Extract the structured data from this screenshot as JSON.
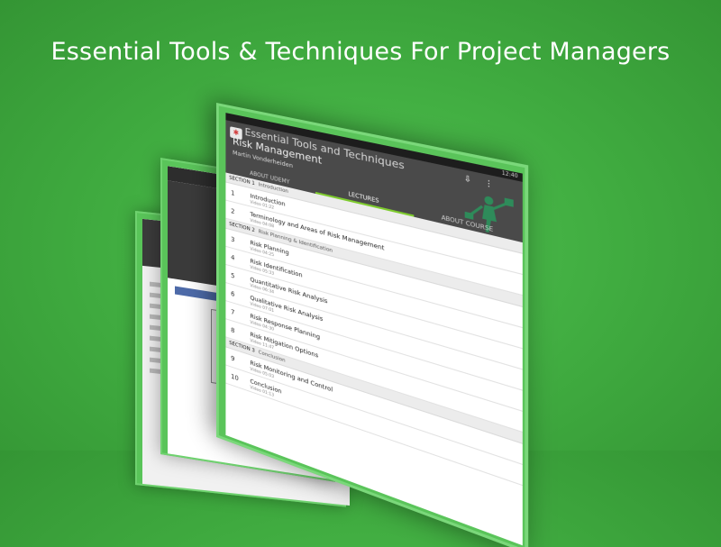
{
  "headline": "Essential Tools & Techniques For Project Managers",
  "colors": {
    "background": "#44b044",
    "accent": "#7ecb2e",
    "appbar": "#4a4a4a"
  },
  "status_bar": {
    "time": "12:40"
  },
  "app": {
    "icon": "udemy-logo-icon",
    "course_title": "Essential Tools and Techniques",
    "lecture_title": "Risk Management",
    "instructor": "Martin Vonderheiden",
    "tabs": [
      {
        "label": "ABOUT UDEMY",
        "active": false
      },
      {
        "label": "LECTURES",
        "active": true
      },
      {
        "label": "ABOUT COURSE",
        "active": false
      }
    ]
  },
  "sections": [
    {
      "label": "SECTION 1",
      "name": "Introduction",
      "lectures": [
        {
          "num": "1",
          "title": "Introduction",
          "sub": "Video 01:22"
        },
        {
          "num": "2",
          "title": "Terminology and Areas of Risk Management",
          "sub": "Video 04:08"
        }
      ]
    },
    {
      "label": "SECTION 2",
      "name": "Risk Planning & Identification",
      "lectures": [
        {
          "num": "3",
          "title": "Risk Planning",
          "sub": "Video 04:25"
        },
        {
          "num": "4",
          "title": "Risk Identification",
          "sub": "Video 05:33"
        },
        {
          "num": "5",
          "title": "Quantitative Risk Analysis",
          "sub": "Video 06:34"
        },
        {
          "num": "6",
          "title": "Qualitative Risk Analysis",
          "sub": "Video 07:01"
        },
        {
          "num": "7",
          "title": "Risk Response Planning",
          "sub": "Video 04:30"
        },
        {
          "num": "8",
          "title": "Risk Mitigation Options",
          "sub": "Video 11:47"
        }
      ]
    },
    {
      "label": "SECTION 3",
      "name": "Conclusion",
      "lectures": [
        {
          "num": "9",
          "title": "Risk Monitoring and Control",
          "sub": "Video 05:03"
        },
        {
          "num": "10",
          "title": "Conclusion",
          "sub": "Video 01:13"
        }
      ]
    }
  ]
}
